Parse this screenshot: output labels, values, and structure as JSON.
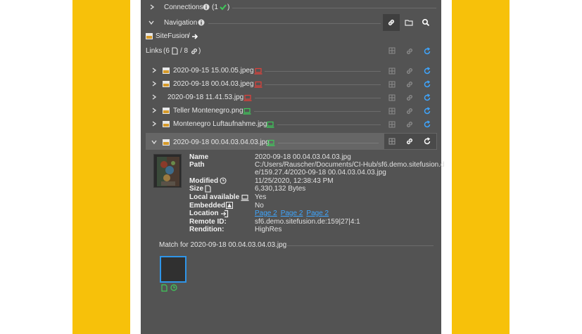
{
  "panel": {
    "connections": {
      "label": "Connections",
      "count": "(1"
    },
    "navigation": {
      "label": "Navigation"
    },
    "breadcrumb": {
      "root": "SiteFusion",
      "sep": "/"
    },
    "links": {
      "label": "Links",
      "open": "(6",
      "sep": "/ 8",
      "close": ")"
    },
    "rows": [
      {
        "name": "2020-09-15 15.00.05.jpeg",
        "status": "error"
      },
      {
        "name": "2020-09-18 00.04.03.jpeg",
        "status": "error"
      },
      {
        "name": "2020-09-18 11.41.53.jpg",
        "status": "error"
      },
      {
        "name": "Teller Montenegro.png",
        "status": "ok"
      },
      {
        "name": "Montenegro Luftaufnahme.jpg",
        "status": "ok"
      },
      {
        "name": "2020-09-18 00.04.03.04.03.jpg",
        "status": "ok"
      }
    ],
    "details": {
      "name_label": "Name",
      "name_value": "2020-09-18 00.04.03.04.03.jpg",
      "path_label": "Path",
      "path_value1": "C:/Users/Rauscher/Documents/CI-Hub/sf6.demo.sitefusion.d",
      "path_value2": "e/159.27.4/2020-09-18 00.04.03.04.03.jpg",
      "modified_label": "Modified",
      "modified_value": "11/25/2020, 12:38:43 PM",
      "size_label": "Size",
      "size_value": "6,330,132 Bytes",
      "local_label": "Local available",
      "local_value": "Yes",
      "embedded_label": "Embedded",
      "embedded_value": "No",
      "location_label": "Location",
      "location_pages": [
        "Page 2",
        "Page 2",
        "Page 2"
      ],
      "remote_label": "Remote ID:",
      "remote_value": "sf6.demo.sitefusion.de:159|27|4:1",
      "rendition_label": "Rendition:",
      "rendition_value": "HighRes"
    },
    "match": {
      "label": "Match for 2020-09-18 00.04.03.04.03.jpg"
    }
  },
  "colors": {
    "panel_bg": "#535353",
    "accent_blue": "#3ea6ff",
    "ok_green": "#3fc95a",
    "error_red": "#e0403a",
    "frame_yellow": "#f7c10a"
  }
}
